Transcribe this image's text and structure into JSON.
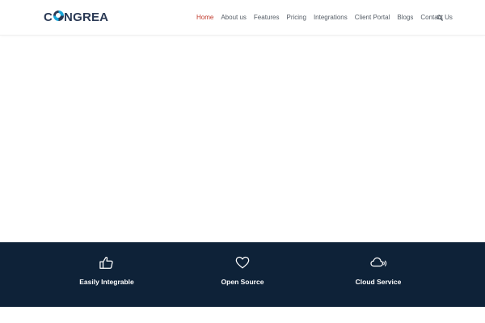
{
  "header": {
    "logo_text": "CONGREA",
    "nav": [
      {
        "label": "Home",
        "active": true
      },
      {
        "label": "About us",
        "active": false
      },
      {
        "label": "Features",
        "active": false
      },
      {
        "label": "Pricing",
        "active": false
      },
      {
        "label": "Integrations",
        "active": false
      },
      {
        "label": "Client Portal",
        "active": false
      },
      {
        "label": "Blogs",
        "active": false
      },
      {
        "label": "Contact Us",
        "active": false
      }
    ],
    "search_icon": "search-icon"
  },
  "features": [
    {
      "label": "Easily Integrable",
      "icon": "thumbs-up-icon"
    },
    {
      "label": "Open Source",
      "icon": "heart-icon"
    },
    {
      "label": "Cloud Service",
      "icon": "cloud-icon"
    }
  ],
  "colors": {
    "accent": "#c0392b",
    "nav_text": "#555d66",
    "band_bg": "#0e2238",
    "logo_dark": "#2b3a55",
    "logo_accent": "#1aa6d9"
  }
}
